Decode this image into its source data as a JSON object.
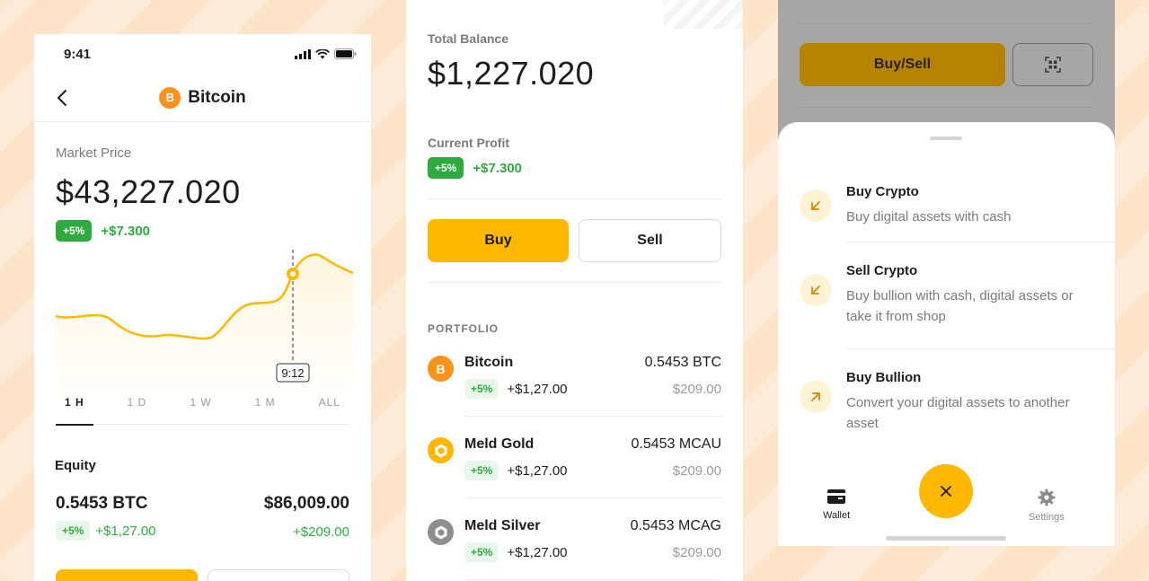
{
  "colors": {
    "accent": "#ffb800",
    "positive": "#2eaa3f",
    "bitcoin": "#f7931a"
  },
  "detail": {
    "status_time": "9:41",
    "nav_title": "Bitcoin",
    "coin_letter": "B",
    "market_price_label": "Market Price",
    "market_price": "$43,227.020",
    "change_pct": "+5%",
    "change_amt": "+$7.300",
    "chart_tooltip": "9:12",
    "tabs": [
      "1 H",
      "1 D",
      "1 W",
      "1 M",
      "ALL"
    ],
    "active_tab": "1 H",
    "equity_title": "Equity",
    "equity": {
      "qty": "0.5453 BTC",
      "pct": "+5%",
      "chg": "+$1,27.00",
      "usd": "$86,009.00",
      "usd_chg": "+$209.00"
    }
  },
  "wallet": {
    "total_label": "Total Balance",
    "total": "$1,227.020",
    "profit_label": "Current Profit",
    "profit_pct": "+5%",
    "profit_amt": "+$7.300",
    "buy_label": "Buy",
    "sell_label": "Sell",
    "portfolio_label": "PORTFOLIO",
    "portfolio": [
      {
        "name": "Bitcoin",
        "qty": "0.5453 BTC",
        "pct": "+5%",
        "chg": "+$1,27.00",
        "usd": "$209.00",
        "icon": "bitcoin-icon"
      },
      {
        "name": "Meld Gold",
        "qty": "0.5453 MCAU",
        "pct": "+5%",
        "chg": "+$1,27.00",
        "usd": "$209.00",
        "icon": "gold-coin-icon"
      },
      {
        "name": "Meld Silver",
        "qty": "0.5453 MCAG",
        "pct": "+5%",
        "chg": "+$1,27.00",
        "usd": "$209.00",
        "icon": "silver-coin-icon"
      }
    ]
  },
  "actions": {
    "buy_sell_label": "Buy/Sell",
    "options": [
      {
        "title": "Buy Crypto",
        "desc": "Buy digital assets with cash"
      },
      {
        "title": "Sell Crypto",
        "desc": "Buy bullion with cash, digital assets or take it from shop"
      },
      {
        "title": "Buy Bullion",
        "desc": "Convert your digital assets to another asset"
      }
    ],
    "nav": {
      "wallet": "Wallet",
      "settings": "Settings"
    }
  }
}
